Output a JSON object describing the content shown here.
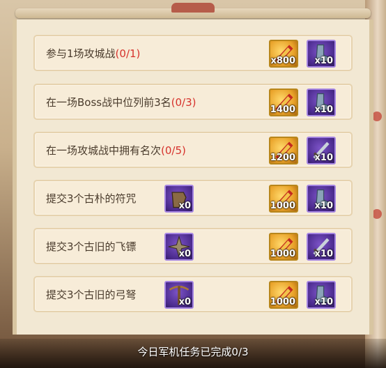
{
  "tasks": [
    {
      "label": "参与1场攻城战",
      "progress": "(0/1)",
      "reward_a_qty": "x800",
      "reward_b_qty": "x10",
      "reward_b_icon": "boot-icon"
    },
    {
      "label": "在一场Boss战中位列前3名",
      "progress": "(0/3)",
      "reward_a_qty": "x1400",
      "reward_b_qty": "x10",
      "reward_b_icon": "boot-icon"
    },
    {
      "label": "在一场攻城战中拥有名次",
      "progress": "(0/5)",
      "reward_a_qty": "x1200",
      "reward_b_qty": "x10",
      "reward_b_icon": "sword-icon"
    },
    {
      "label": "提交3个古朴的符咒",
      "progress": "",
      "submit_qty": "x0",
      "submit_icon": "charm-icon",
      "reward_a_qty": "x1000",
      "reward_b_qty": "x10",
      "reward_b_icon": "boot-icon"
    },
    {
      "label": "提交3个古旧的飞镖",
      "progress": "",
      "submit_qty": "x0",
      "submit_icon": "shuriken-icon",
      "reward_a_qty": "x1000",
      "reward_b_qty": "x10",
      "reward_b_icon": "sword-icon"
    },
    {
      "label": "提交3个古旧的弓弩",
      "progress": "",
      "submit_qty": "x0",
      "submit_icon": "crossbow-icon",
      "reward_a_qty": "x1000",
      "reward_b_qty": "x10",
      "reward_b_icon": "boot-icon"
    }
  ],
  "reward_a_icon": "military-merit-icon",
  "footer": {
    "status": "今日军机任务已完成0/3"
  },
  "colors": {
    "progress": "#d6322c",
    "text": "#4a3b2c",
    "panel": "#f2e8d3"
  }
}
